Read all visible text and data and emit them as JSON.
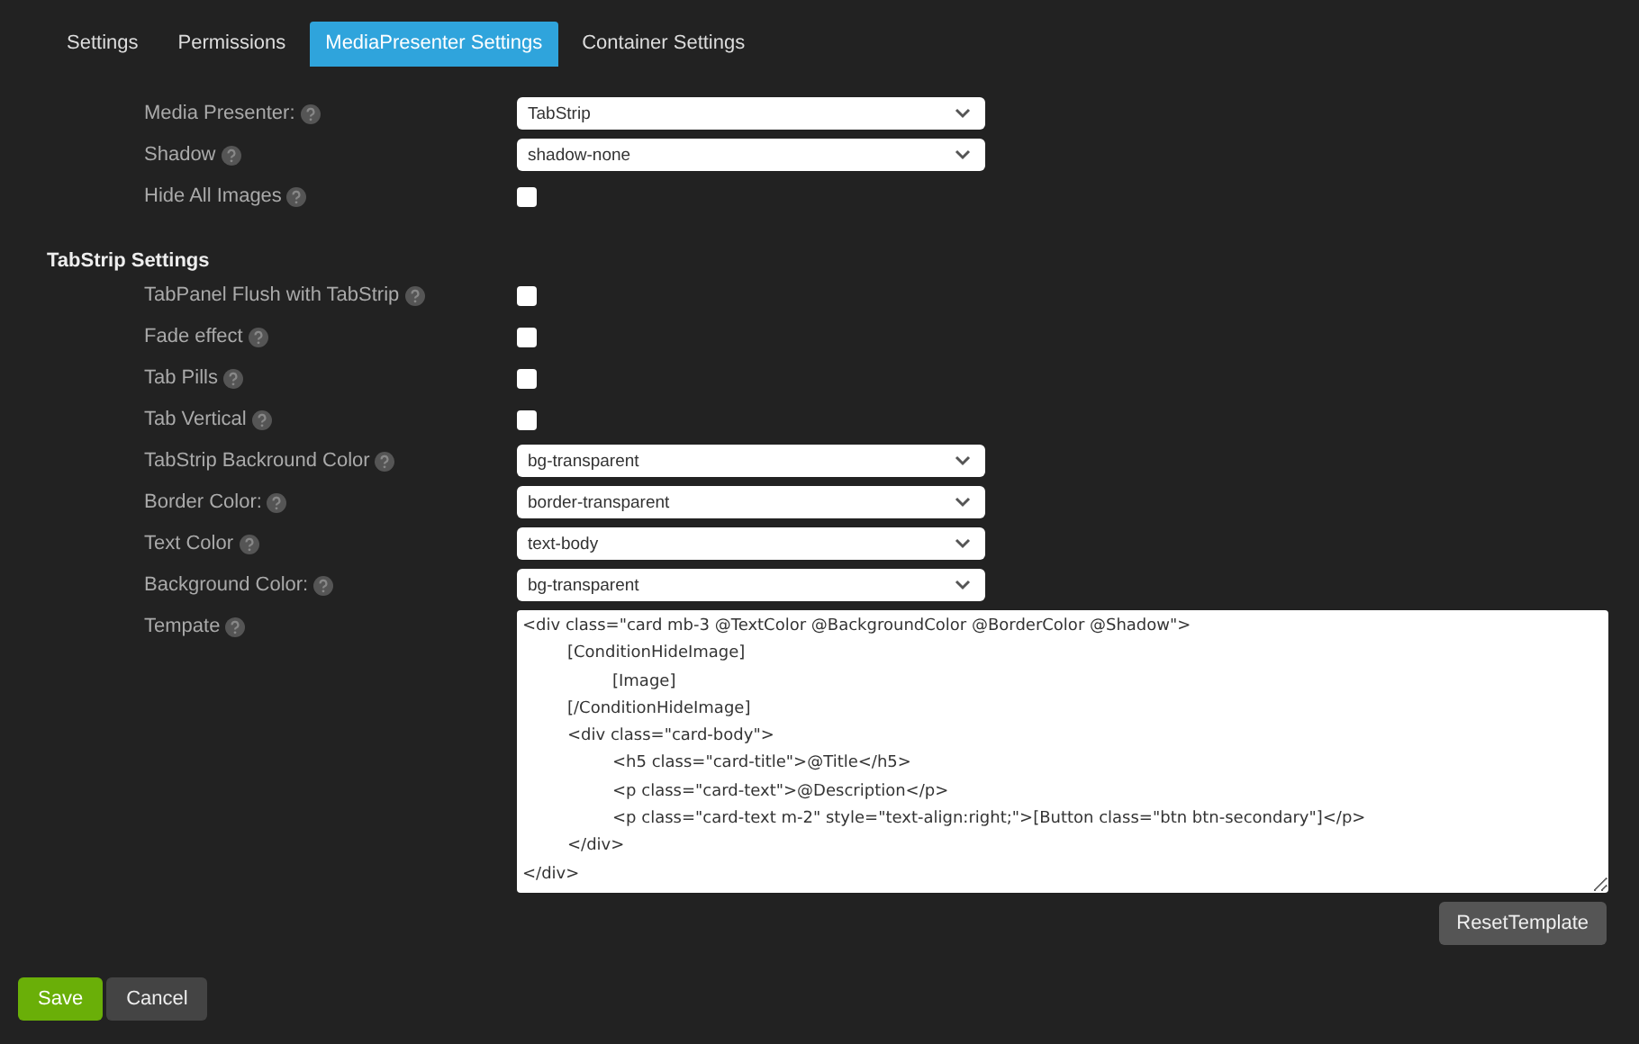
{
  "tabs": [
    {
      "label": "Settings",
      "selected": false
    },
    {
      "label": "Permissions",
      "selected": false
    },
    {
      "label": "MediaPresenter Settings",
      "selected": true
    },
    {
      "label": "Container Settings",
      "selected": false
    }
  ],
  "fields": [
    {
      "kind": "select",
      "label": "Media Presenter:",
      "value": "TabStrip"
    },
    {
      "kind": "select",
      "label": "Shadow",
      "value": "shadow-none"
    },
    {
      "kind": "checkbox",
      "label": "Hide All Images",
      "checked": false
    }
  ],
  "tabstrip_settings": {
    "heading": "TabStrip Settings",
    "fields": [
      {
        "kind": "checkbox",
        "label": "TabPanel Flush with TabStrip",
        "checked": false
      },
      {
        "kind": "checkbox",
        "label": "Fade effect",
        "checked": false
      },
      {
        "kind": "checkbox",
        "label": "Tab Pills",
        "checked": false
      },
      {
        "kind": "checkbox",
        "label": "Tab Vertical",
        "checked": false
      },
      {
        "kind": "select",
        "label": "TabStrip Backround Color",
        "value": "bg-transparent"
      },
      {
        "kind": "select",
        "label": "Border Color:",
        "value": "border-transparent"
      },
      {
        "kind": "select",
        "label": "Text Color",
        "value": "text-body"
      },
      {
        "kind": "select",
        "label": "Background Color:",
        "value": "bg-transparent"
      },
      {
        "kind": "textarea",
        "label": "Tempate",
        "value": "<div class=\"card mb-3 @TextColor @BackgroundColor @BorderColor @Shadow\">\n\t[ConditionHideImage]\n\t\t[Image]\n\t[/ConditionHideImage]\n\t<div class=\"card-body\">\n\t\t<h5 class=\"card-title\">@Title</h5>\n\t\t<p class=\"card-text\">@Description</p>\n\t\t<p class=\"card-text m-2\" style=\"text-align:right;\">[Button class=\"btn btn-secondary\"]</p>\n\t</div>\n</div>"
      }
    ]
  },
  "reset_button": "ResetTemplate",
  "buttons": [
    {
      "kind": "primary",
      "label": "Save"
    },
    {
      "kind": "secondary",
      "label": "Cancel"
    }
  ]
}
